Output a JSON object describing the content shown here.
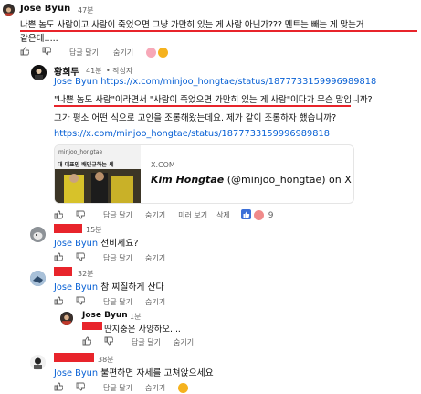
{
  "c1": {
    "author": "Jose Byun",
    "time": "47분",
    "line1": "나쁜 놈도 사람이고 사람이 죽었으면 그냥 가만히 있는 게 사람 아닌가??? 멘트는 빼는 게 맞는거",
    "line2": "같은데.....",
    "like": "답글 달기",
    "hide": "숨기기"
  },
  "c2": {
    "author": "황희두",
    "time": "41분",
    "badge": "작성자",
    "mention": "Jose Byun",
    "link1": "https://x.com/minjoo_hongtae/status/1877733159996989818",
    "quote": "\"나쁜 놈도 사람\"이라면서 \"사람이 죽었으면 가만히 있는 게 사람\"이다가 무슨 말입니까?",
    "para2": "그가 평소 어떤 식으로 고인을 조롱해왔는데요. 제가 같이 조롱하자 했습니까?",
    "link2": "https://x.com/minjoo_hongtae/status/1877733159996989818",
    "card_domain": "X.COM",
    "card_title_name": "Kim Hongtae",
    "card_title_rest": "(@minjoo_hongtae) on X",
    "thumb_handle": "minjoo_hongtae",
    "thumb_caption": "대 대표인 배민규하는 세",
    "reply": "답글 달기",
    "hide": "숨기기",
    "translate": "미러 보기",
    "delete": "삭제",
    "count": "9"
  },
  "c3": {
    "time": "15분",
    "mention": "Jose Byun",
    "text": "선비세요?",
    "reply": "답글 달기",
    "hide": "숨기기"
  },
  "c4": {
    "time": "32분",
    "mention": "Jose Byun",
    "text": "참 찌질하게 산다",
    "reply": "답글 달기",
    "hide": "숨기기"
  },
  "c5": {
    "author": "Jose Byun",
    "time": "1분",
    "text": "딴지충은 사양하오....",
    "reply": "답글 달기",
    "hide": "숨기기"
  },
  "c6": {
    "time": "38분",
    "mention": "Jose Byun",
    "text": "불편하면 자세를 고쳐앉으세요",
    "reply": "답글 달기",
    "hide": "숨기기"
  },
  "colors": {
    "link": "#065fd4",
    "redact": "#e8242b",
    "meta": "#606060"
  }
}
